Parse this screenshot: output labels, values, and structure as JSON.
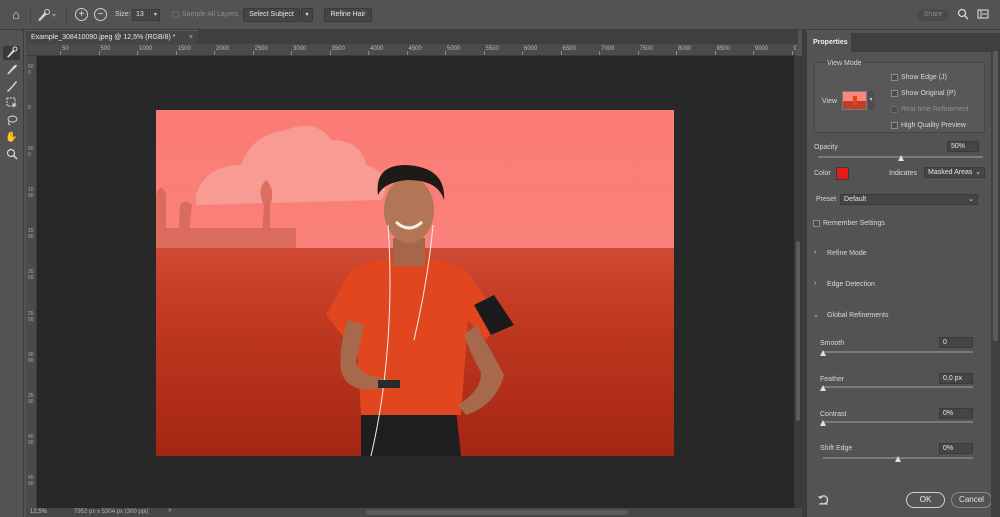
{
  "options_bar": {
    "size_label": "Size:",
    "size_value": "13",
    "sample_all_layers": "Sample All Layers",
    "select_subject": "Select Subject",
    "refine_hair": "Refine Hair",
    "share": "Share"
  },
  "document": {
    "tab_title": "Example_308410090.jpeg @ 12,5% (RGB/8) *",
    "ruler_ticks": [
      "50",
      "500",
      "1000",
      "1500",
      "2000",
      "2500",
      "3000",
      "3500",
      "4000",
      "4500",
      "5000",
      "5500",
      "6000",
      "6500",
      "7000",
      "7500",
      "8000",
      "8500",
      "9000",
      "9500"
    ],
    "vruler_ticks": [
      "500",
      "0",
      "500",
      "1000",
      "1500",
      "2000",
      "2500",
      "3000",
      "3500",
      "4000",
      "4500"
    ]
  },
  "status": {
    "zoom": "12,5%",
    "dimensions": "7952 px x 5304 px (300 ppi)",
    "arrow": ">"
  },
  "properties": {
    "tab": "Properties",
    "view_mode_title": "View Mode",
    "view_label": "View",
    "show_edge": "Show Edge (J)",
    "show_original": "Show Original (P)",
    "realtime_refinement": "Real-time Refinement",
    "high_quality_preview": "High Quality Preview",
    "opacity_label": "Opacity",
    "opacity_value": "50%",
    "opacity_level": 0.5,
    "color_label": "Color",
    "mask_color": "#e41b17",
    "indicates_label": "Indicates",
    "indicates_value": "Masked Areas",
    "preset_label": "Preset",
    "preset_value": "Default",
    "remember_settings": "Remember Settings",
    "refine_mode": "Refine Mode",
    "edge_detection": "Edge Detection",
    "global_refinements": "Global Refinements",
    "smooth_label": "Smooth",
    "smooth_value": "0",
    "smooth_level": 0,
    "feather_label": "Feather",
    "feather_value": "0,0 px",
    "feather_level": 0,
    "contrast_label": "Contrast",
    "contrast_value": "0%",
    "contrast_level": 0,
    "shift_edge_label": "Shift Edge",
    "shift_edge_value": "0%",
    "shift_edge_level": 0.5,
    "ok": "OK",
    "cancel": "Cancel"
  },
  "colors": {
    "overlay": "#ff3b30",
    "panel": "#535353",
    "canvas": "#282828"
  },
  "icons": [
    "home-icon",
    "quick-selection-brush-icon",
    "add-selection-icon",
    "subtract-selection-icon",
    "search-icon",
    "workspace-icon",
    "refine-edge-brush-icon",
    "brush-icon",
    "object-selection-icon",
    "lasso-icon",
    "hand-icon",
    "zoom-icon",
    "undo-icon"
  ]
}
